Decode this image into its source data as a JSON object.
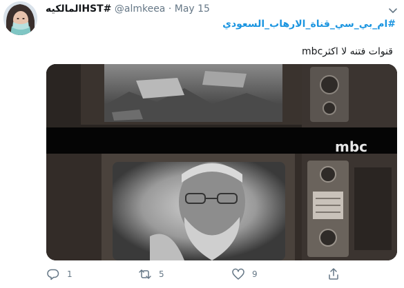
{
  "author": {
    "display_name": "المالكيهHST#",
    "handle": "@almkeea",
    "separator": "·",
    "date": "May 15"
  },
  "tweet": {
    "hashtag": "#ام_بي_سي_قناة_الارهاب_السعودي",
    "text": "قنوات فتنه لا اكثرmbc"
  },
  "media": {
    "watermark": "mbc"
  },
  "actions": {
    "reply_count": "1",
    "retweet_count": "5",
    "like_count": "9"
  },
  "icons": {
    "reply": "reply-icon",
    "retweet": "retweet-icon",
    "like": "heart-icon",
    "share": "share-icon",
    "caret": "chevron-down-icon"
  }
}
